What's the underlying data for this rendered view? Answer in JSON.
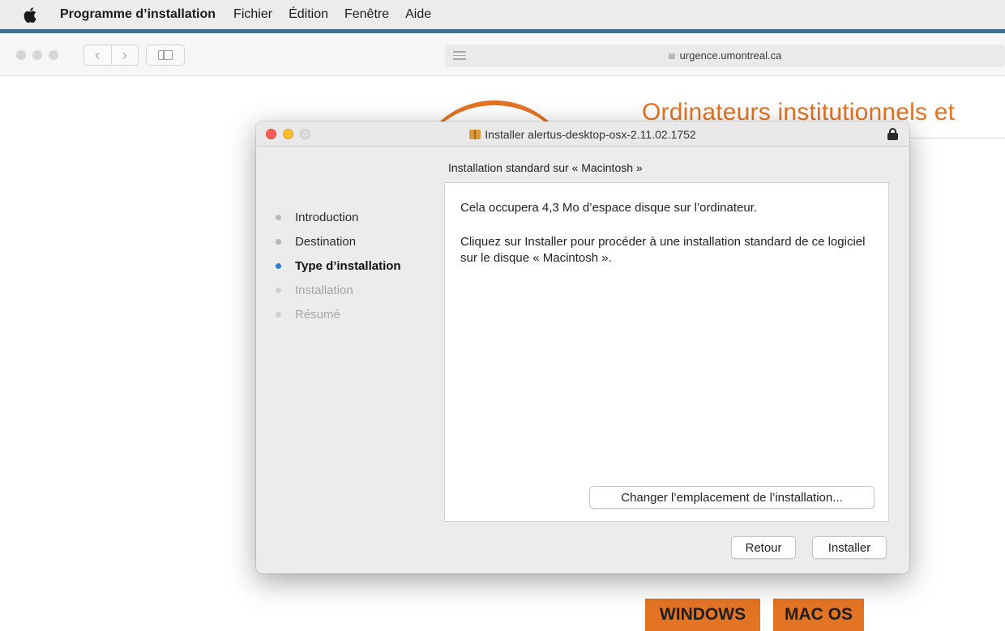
{
  "menubar": {
    "apple_icon": "apple-logo-icon",
    "app_name": "Programme d’installation",
    "items": [
      "Fichier",
      "Édition",
      "Fenêtre",
      "Aide"
    ]
  },
  "browser": {
    "url": "urgence.umontreal.ca",
    "back_glyph": "‹",
    "forward_glyph": "›"
  },
  "webpage": {
    "heading": "Ordinateurs institutionnels et",
    "buttons": [
      "WINDOWS",
      "MAC OS"
    ],
    "accent_color": "#e37424"
  },
  "installer": {
    "title": "Installer alertus-desktop-osx-2.11.02.1752",
    "subtitle": "Installation standard sur « Macintosh »",
    "steps": [
      {
        "label": "Introduction",
        "state": "done"
      },
      {
        "label": "Destination",
        "state": "done"
      },
      {
        "label": "Type d’installation",
        "state": "current"
      },
      {
        "label": "Installation",
        "state": "pending"
      },
      {
        "label": "Résumé",
        "state": "pending"
      }
    ],
    "space_text": "Cela occupera 4,3 Mo d’espace disque sur l’ordinateur.",
    "instruction_text": "Cliquez sur Installer pour procéder à une installation standard de ce logiciel sur le disque « Macintosh ».",
    "change_location_label": "Changer l’emplacement de l’installation...",
    "back_label": "Retour",
    "install_label": "Installer",
    "current_step_color": "#2f7de1"
  }
}
